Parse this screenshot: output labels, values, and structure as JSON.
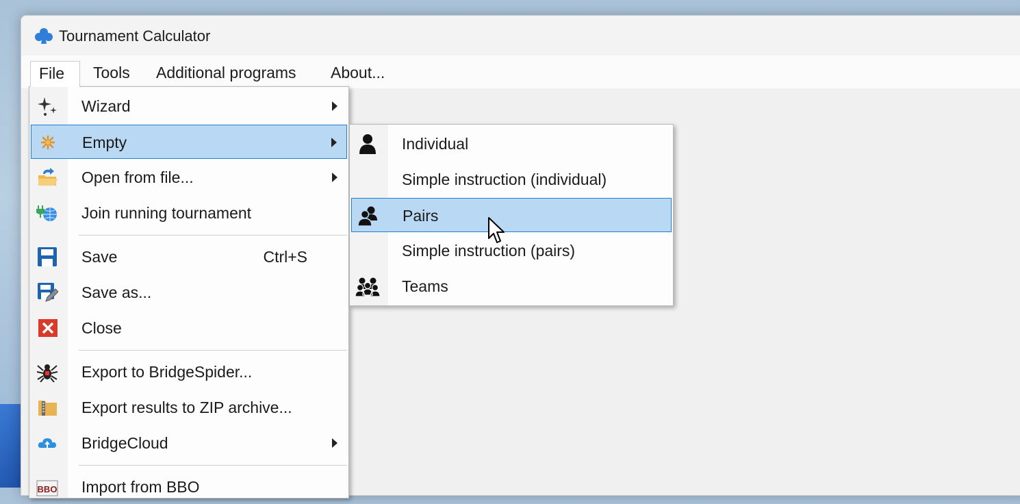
{
  "window": {
    "title": "Tournament Calculator"
  },
  "menubar": {
    "items": [
      {
        "label": "File",
        "open": true
      },
      {
        "label": "Tools"
      },
      {
        "label": "Additional programs"
      },
      {
        "label": "About..."
      }
    ]
  },
  "file_menu": {
    "items": [
      {
        "label": "Wizard",
        "icon": "sparkle-icon",
        "submenu": true
      },
      {
        "label": "Empty",
        "icon": "star-icon",
        "submenu": true,
        "highlighted": true
      },
      {
        "label": "Open from file...",
        "icon": "open-folder-icon",
        "submenu": true
      },
      {
        "label": "Join running tournament",
        "icon": "network-plug-icon"
      },
      {
        "label": "Save",
        "icon": "floppy-disk-icon",
        "shortcut": "Ctrl+S"
      },
      {
        "label": "Save as...",
        "icon": "floppy-pencil-icon"
      },
      {
        "label": "Close",
        "icon": "red-x-icon"
      },
      {
        "label": "Export to BridgeSpider...",
        "icon": "spider-icon"
      },
      {
        "label": "Export results to ZIP archive...",
        "icon": "zip-archive-icon"
      },
      {
        "label": "BridgeCloud",
        "icon": "cloud-upload-icon",
        "submenu": true
      },
      {
        "label": "Import from BBO",
        "icon": "bbo-icon"
      }
    ]
  },
  "empty_submenu": {
    "items": [
      {
        "label": "Individual",
        "icon": "person-icon"
      },
      {
        "label": "Simple instruction (individual)"
      },
      {
        "label": "Pairs",
        "icon": "two-people-icon",
        "highlighted": true
      },
      {
        "label": "Simple instruction (pairs)"
      },
      {
        "label": "Teams",
        "icon": "team-icon"
      }
    ]
  },
  "colors": {
    "highlight_bg": "#b9d8f3",
    "highlight_border": "#1f7fd2",
    "menu_bg": "#fdfdfd",
    "gutter_bg": "#f3f3f3"
  }
}
